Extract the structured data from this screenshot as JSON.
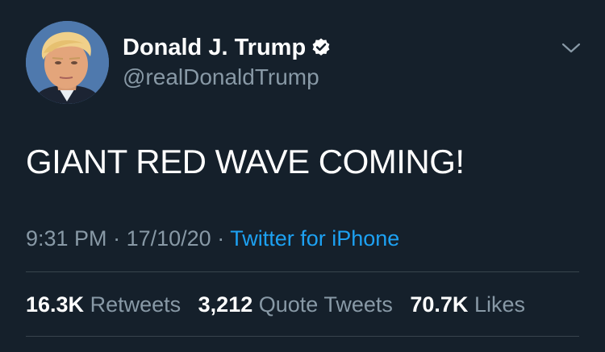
{
  "colors": {
    "background": "#15202b",
    "primary_text": "#ffffff",
    "secondary_text": "#8899a6",
    "link": "#1da1f2",
    "divider": "#38444d"
  },
  "author": {
    "display_name": "Donald J. Trump",
    "handle": "@realDonaldTrump",
    "verified_icon": "verified-badge-icon",
    "avatar": "profile-photo"
  },
  "menu": {
    "icon": "chevron-down-icon"
  },
  "tweet": {
    "text": "GIANT RED WAVE COMING!"
  },
  "meta": {
    "time": "9:31 PM",
    "separator_1": "·",
    "date": "17/10/20",
    "separator_2": "·",
    "source": "Twitter for iPhone"
  },
  "stats": {
    "retweets_count": "16.3K",
    "retweets_label": "Retweets",
    "quotes_count": "3,212",
    "quotes_label": "Quote Tweets",
    "likes_count": "70.7K",
    "likes_label": "Likes"
  }
}
